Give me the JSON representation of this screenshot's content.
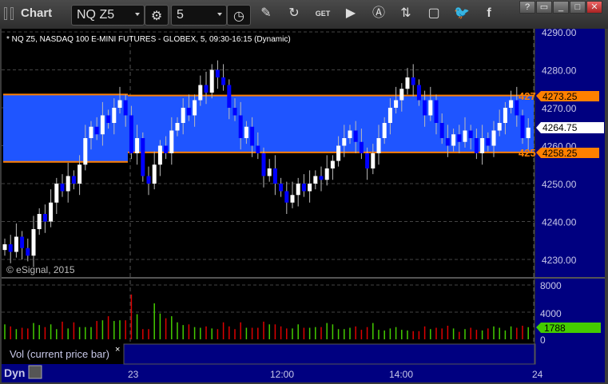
{
  "window": {
    "title": "Chart",
    "symbol": "NQ Z5",
    "interval": "5",
    "controls": [
      "?",
      "restore",
      "minimize",
      "maximize",
      "close"
    ]
  },
  "toolbar": {
    "icons": [
      "settings-gear-icon",
      "clock-icon",
      "pencil-icon",
      "study-icon",
      "get-icon",
      "play-icon",
      "alert-icon",
      "link-icon",
      "comment-icon",
      "twitter-icon",
      "facebook-icon"
    ]
  },
  "chart": {
    "header": "* NQ Z5, NASDAQ 100 E-MINI FUTURES - GLOBEX, 5, 09:30-16:15 (Dynamic)",
    "copyright": "© eSignal, 2015",
    "price_ticks": [
      "4290.00",
      "4280.00",
      "4270.00",
      "4260.00",
      "4250.00",
      "4240.00",
      "4230.00"
    ],
    "price_tick_values": [
      4290,
      4280,
      4270,
      4260,
      4250,
      4240,
      4230
    ],
    "last_price": "4264.75",
    "level_high": "4273.25",
    "level_high_short": "427",
    "level_low": "4258.25",
    "level_low_short": "425",
    "volume_ticks": [
      "8000",
      "4000",
      "0"
    ],
    "volume_last": "1788",
    "volume_label": "Vol (current price bar)",
    "volume_close": "×",
    "time_labels": [
      "23",
      "12:00",
      "14:00",
      "24"
    ],
    "dyn_label": "Dyn",
    "colors": {
      "up_candle": "#ffffff",
      "down_candle": "#0000ff",
      "zone": "#1f55ff",
      "level": "#ff8000",
      "vol_up": "#44cc00",
      "vol_down": "#dd0000",
      "axis_bg": "#000080"
    }
  },
  "chart_data": {
    "type": "candlestick",
    "close": [
      4234,
      4232,
      4236,
      4233,
      4231,
      4238,
      4242,
      4240,
      4245,
      4250,
      4248,
      4252,
      4250,
      4255,
      4262,
      4265,
      4263,
      4268,
      4266,
      4270,
      4272,
      4268,
      4258,
      4262,
      4252,
      4250,
      4255,
      4260,
      4258,
      4264,
      4266,
      4270,
      4268,
      4272,
      4276,
      4274,
      4280,
      4278,
      4276,
      4270,
      4268,
      4262,
      4265,
      4260,
      4258,
      4252,
      4254,
      4250,
      4248,
      4245,
      4247,
      4250,
      4248,
      4250,
      4252,
      4251,
      4254,
      4256,
      4260,
      4262,
      4264,
      4261,
      4258,
      4254,
      4258,
      4262,
      4266,
      4270,
      4272,
      4275,
      4278,
      4276,
      4272,
      4268,
      4272,
      4266,
      4262,
      4260,
      4263,
      4261,
      4264,
      4262,
      4258,
      4262,
      4260,
      4264,
      4266,
      4270,
      4272,
      4268,
      4262,
      4264.75
    ],
    "volume": [
      2200,
      1900,
      1500,
      1700,
      1600,
      2400,
      2100,
      1800,
      2200,
      1500,
      2600,
      1600,
      2500,
      1800,
      1800,
      1800,
      2700,
      2800,
      3400,
      2700,
      2800,
      2800,
      6600,
      3700,
      1500,
      1500,
      5300,
      3800,
      3100,
      3400,
      2500,
      2100,
      2200,
      1800,
      1700,
      1900,
      1600,
      1500,
      2500,
      1900,
      1500,
      2500,
      1700,
      1700,
      1700,
      2600,
      2200,
      2200,
      1900,
      1600,
      1600,
      2200,
      1700,
      1700,
      1800,
      1800,
      2400,
      2200,
      1500,
      1500,
      1700,
      1900,
      1400,
      1800,
      2400,
      1400,
      1300,
      1600,
      1800,
      1400,
      1300,
      1200,
      1200,
      1900,
      1500,
      1700,
      1600,
      2000,
      1600,
      1100,
      1500,
      1700,
      1400,
      1300,
      1600,
      1900,
      1700,
      1300,
      1900,
      1700,
      2000,
      1788
    ],
    "ylim": [
      4230,
      4290
    ],
    "vol_ylim": [
      0,
      8000
    ]
  }
}
